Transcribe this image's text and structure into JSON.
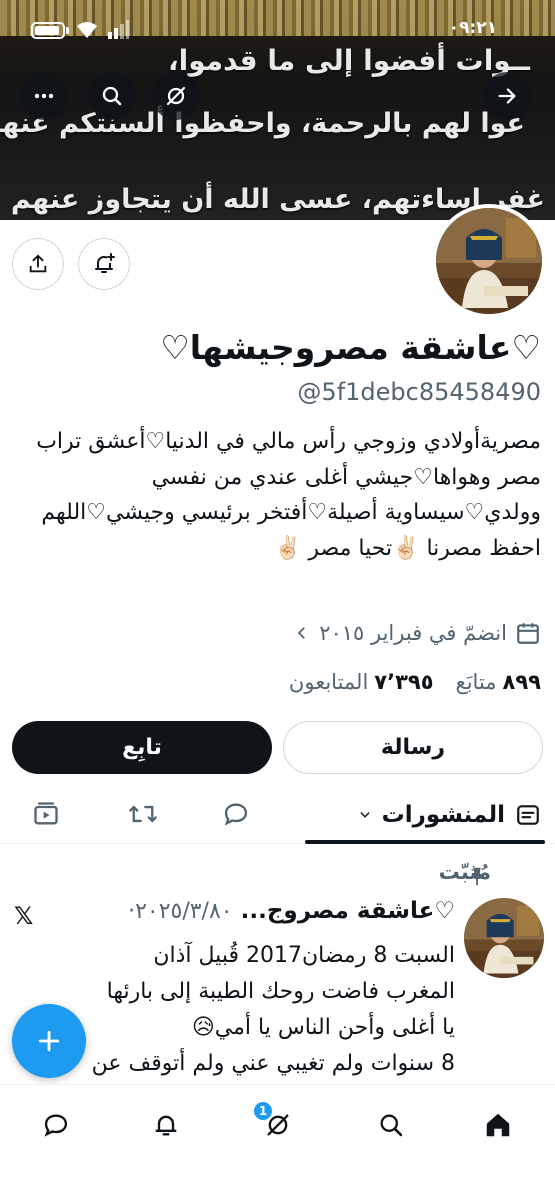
{
  "status_bar": {
    "time": "٠٩:٢١"
  },
  "banner": {
    "line1": "ــوات أفضوا إلى ما قدموا،",
    "line2": "عوا لهم بالرحمة، واحفظوا ألسنتكم عنهم،",
    "line3": "غفر إساءتهم، عسى الله أن يتجاوز عنهم وعن"
  },
  "profile": {
    "display_name": "♡عاشقة مصروجيشها♡",
    "handle": "@5f1debc85458490",
    "bio": "مصريةأولادي وزوجي رأس مالي في الدنيا♡أعشق تراب مصر وهواها♡جيشي أغلى عندي من نفسي وولدي♡سيساوية أصيلة♡أفتخر برئيسي وجيشي♡اللهم احفظ مصرنا ✌🏻تحيا مصر ✌🏻",
    "joined": "انضمّ في فبراير ٢٠١٥",
    "following_count": "٨٩٩",
    "following_label": "متابَع",
    "followers_count": "٧٬٣٩٥",
    "followers_label": "المتابعون"
  },
  "actions": {
    "follow": "تابِع",
    "message": "رسالة"
  },
  "tabs": {
    "active": "المنشورات"
  },
  "post": {
    "pinned_label": "مُثبّت",
    "author": "♡عاشقة مصروج...",
    "date": "٢٠٢٥/٣/٨٠·",
    "text_line1": "السبت 8 رمضان2017 قُبيل آذان",
    "text_line2": "المغرب فاضت روحك الطيبة إلى بارئها",
    "text_line3": "يا أغلى وأحن الناس يا أمي😥",
    "text_line4": "8 سنوات ولم تغيبي عني ولم أتوقف عن"
  },
  "bottom_nav": {
    "badge": "1"
  },
  "colors": {
    "accent": "#1d9bf0",
    "text": "#0f1419",
    "muted": "#536471"
  },
  "icons": [
    "back-arrow-icon",
    "hide-icon",
    "search-icon",
    "more-icon",
    "share-icon",
    "notify-icon",
    "calendar-icon",
    "chevron-icon",
    "posts-icon",
    "reply-icon",
    "repost-icon",
    "media-icon",
    "pin-icon",
    "x-logo-icon",
    "compose-icon",
    "home-icon",
    "grok-icon",
    "bell-icon",
    "messages-icon"
  ]
}
